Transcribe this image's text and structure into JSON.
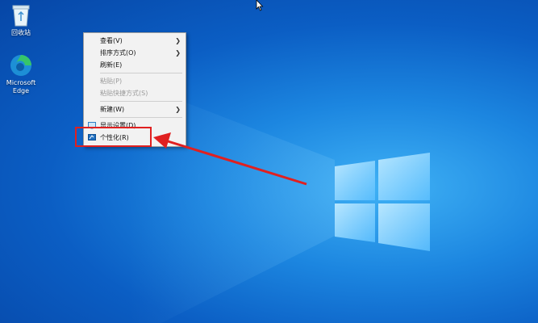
{
  "desktop": {
    "icons": [
      {
        "id": "recycle-bin",
        "label": "回收站",
        "icon": "recycle-bin-icon"
      },
      {
        "id": "edge",
        "label": "Microsoft\nEdge",
        "icon": "edge-icon"
      }
    ]
  },
  "context_menu": {
    "items": [
      {
        "label": "查看(V)",
        "submenu": true,
        "disabled": false
      },
      {
        "label": "排序方式(O)",
        "submenu": true,
        "disabled": false
      },
      {
        "label": "刷新(E)",
        "submenu": false,
        "disabled": false
      },
      {
        "label": "粘贴(P)",
        "submenu": false,
        "disabled": true
      },
      {
        "label": "粘贴快捷方式(S)",
        "submenu": false,
        "disabled": true
      },
      {
        "label": "新建(W)",
        "submenu": true,
        "disabled": false
      },
      {
        "label": "显示设置(D)",
        "submenu": false,
        "disabled": false,
        "icon": "display-icon"
      },
      {
        "label": "个性化(R)",
        "submenu": false,
        "disabled": false,
        "icon": "personalize-icon"
      }
    ]
  },
  "annotation": {
    "color": "#e02020"
  },
  "colors": {
    "menu_bg": "#f2f2f2",
    "disabled_text": "#9a9a9a"
  }
}
